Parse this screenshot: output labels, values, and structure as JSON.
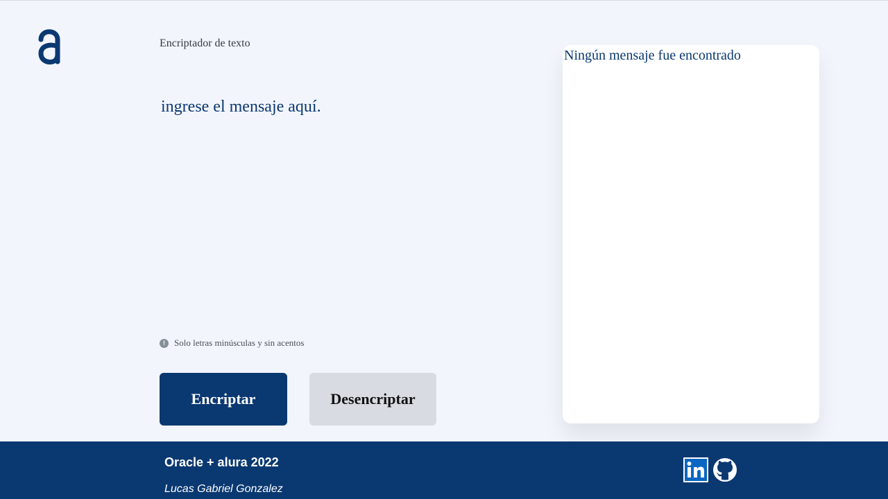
{
  "header": {
    "logo_icon": "alura-logo-icon",
    "title": "Encriptador de texto"
  },
  "input": {
    "placeholder": "ingrese el mensaje aquí.",
    "value": ""
  },
  "hint": {
    "icon": "info-icon",
    "icon_glyph": "!",
    "text": "Solo letras minúsculas y sin acentos"
  },
  "buttons": {
    "encrypt_label": "Encriptar",
    "decrypt_label": "Desencriptar"
  },
  "output": {
    "empty_text": "Ningún mensaje fue encontrado"
  },
  "footer": {
    "title": "Oracle + alura 2022",
    "author": "Lucas Gabriel Gonzalez",
    "social": [
      {
        "icon": "linkedin-icon"
      },
      {
        "icon": "github-icon"
      }
    ]
  },
  "colors": {
    "primary": "#0a3871",
    "background": "#f3f5fc",
    "secondary_button": "#d8dce2",
    "panel": "#ffffff"
  }
}
